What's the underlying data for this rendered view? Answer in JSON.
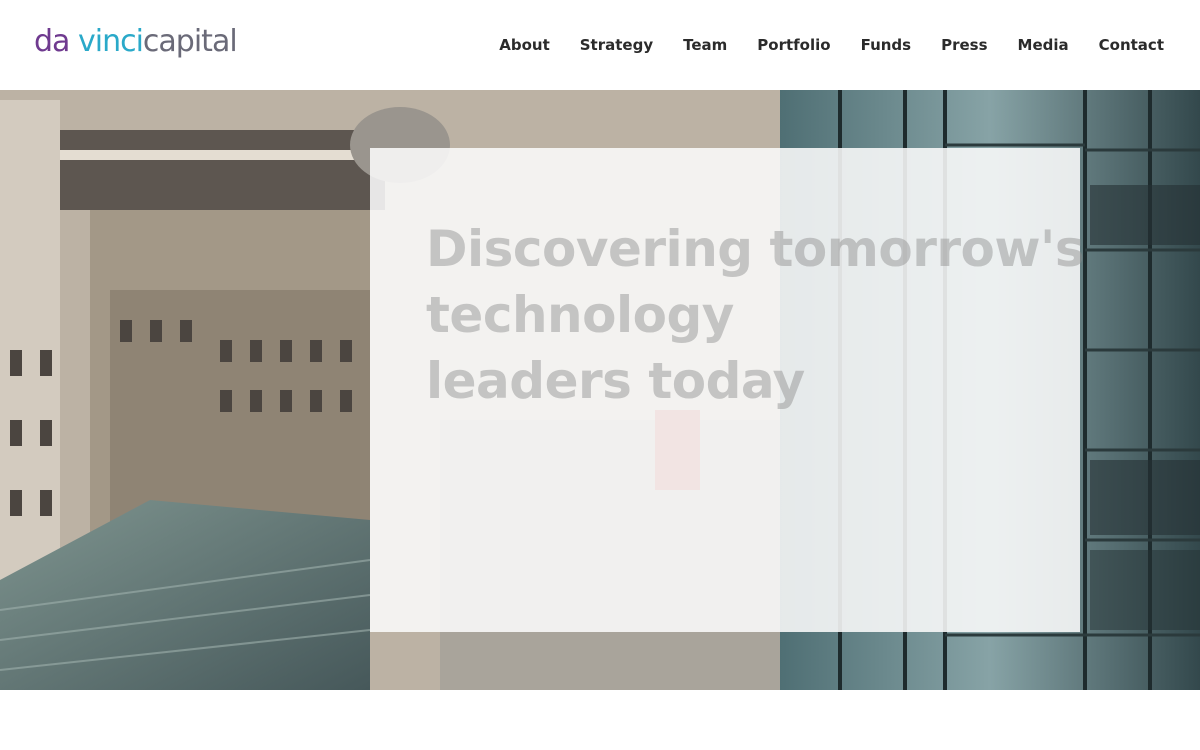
{
  "brand": {
    "logo_part1": "da",
    "logo_part2": "vinci",
    "logo_part3": "capital",
    "colors": {
      "purple": "#6f3a8f",
      "cyan": "#2aa9c9",
      "gray": "#6a6a78"
    }
  },
  "nav": {
    "items": [
      {
        "label": "About"
      },
      {
        "label": "Strategy"
      },
      {
        "label": "Team"
      },
      {
        "label": "Portfolio"
      },
      {
        "label": "Funds"
      },
      {
        "label": "Press"
      },
      {
        "label": "Media"
      },
      {
        "label": "Contact"
      }
    ]
  },
  "hero": {
    "headline_line1": "Discovering tomorrow's",
    "headline_line2": "technology",
    "headline_line3": "leaders today"
  }
}
